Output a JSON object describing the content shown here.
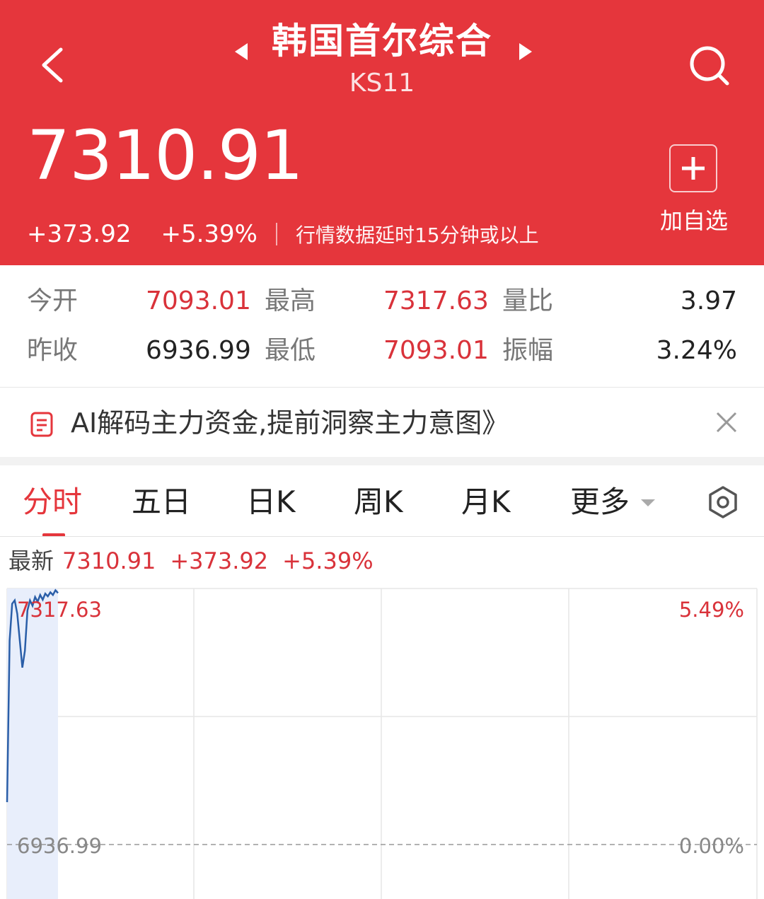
{
  "header": {
    "title": "韩国首尔综合",
    "code": "KS11",
    "price": "7310.91",
    "change": "+373.92",
    "change_pct": "+5.39%",
    "delay_note": "行情数据延时15分钟或以上",
    "add_watch_label": "加自选",
    "bg_color": "#e5363c"
  },
  "stats": {
    "open_label": "今开",
    "open_value": "7093.01",
    "high_label": "最高",
    "high_value": "7317.63",
    "vol_ratio_label": "量比",
    "vol_ratio_value": "3.97",
    "prev_close_label": "昨收",
    "prev_close_value": "6936.99",
    "low_label": "最低",
    "low_value": "7093.01",
    "amplitude_label": "振幅",
    "amplitude_value": "3.24%"
  },
  "banner": {
    "text": "AI解码主力资金,提前洞察主力意图》"
  },
  "tabs": [
    {
      "label": "分时",
      "active": true
    },
    {
      "label": "五日"
    },
    {
      "label": "日K"
    },
    {
      "label": "周K"
    },
    {
      "label": "月K"
    },
    {
      "label": "更多"
    }
  ],
  "latest": {
    "label": "最新",
    "price": "7310.91",
    "change": "+373.92",
    "change_pct": "+5.39%"
  },
  "icons": [
    "back-icon",
    "search-icon",
    "prev-arrow-icon",
    "next-arrow-icon",
    "plus-icon",
    "document-icon",
    "close-icon",
    "caret-down-icon",
    "settings-hexagon-icon"
  ],
  "chart_data": {
    "type": "line",
    "series": [
      {
        "values": [
          7000,
          7240,
          7295,
          7300,
          7280,
          7240,
          7200,
          7225,
          7285,
          7300,
          7292,
          7305,
          7298,
          7308,
          7301,
          7310,
          7306,
          7312,
          7308,
          7315,
          7310.91
        ]
      }
    ],
    "ylim": [
      6936.99,
      7317.63
    ],
    "y_top_label": "7317.63",
    "y_bottom_label": "6936.99",
    "pct_top_label": "5.49%",
    "pct_bottom_label": "0.00%",
    "line_color": "#2a5ea8",
    "fill_color": "#e8eefb"
  }
}
